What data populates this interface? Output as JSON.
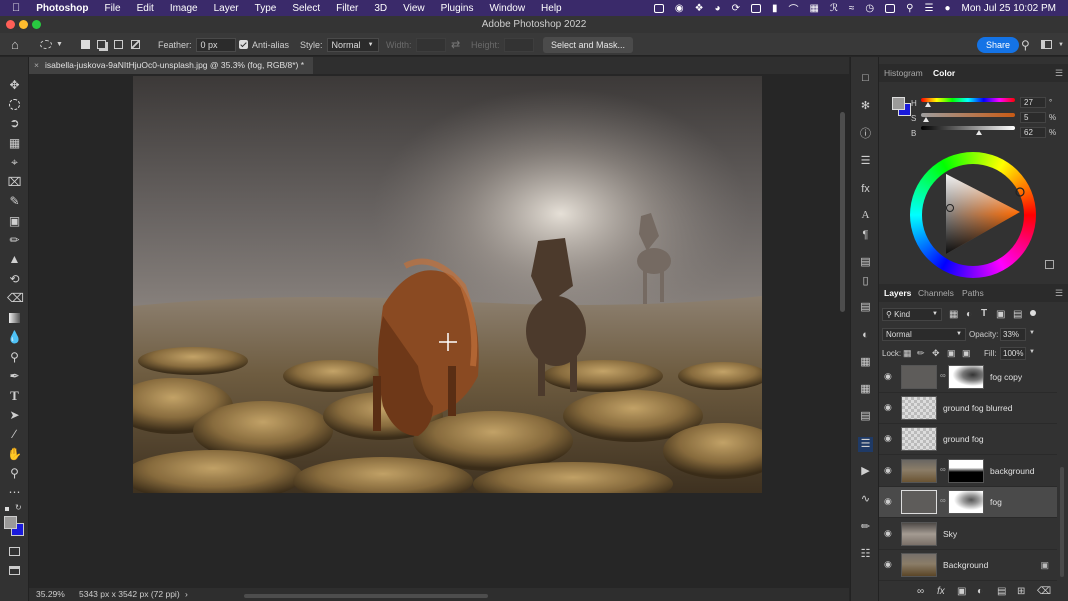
{
  "menubar": {
    "app": "Photoshop",
    "items": [
      "File",
      "Edit",
      "Image",
      "Layer",
      "Type",
      "Select",
      "Filter",
      "3D",
      "View",
      "Plugins",
      "Window",
      "Help"
    ],
    "datetime": "Mon Jul 25  10:02 PM"
  },
  "window": {
    "title": "Adobe Photoshop 2022"
  },
  "options": {
    "feather_label": "Feather:",
    "feather_value": "0 px",
    "antialias_label": "Anti-alias",
    "style_label": "Style:",
    "style_value": "Normal",
    "width_label": "Width:",
    "height_label": "Height:",
    "select_mask_label": "Select and Mask...",
    "share_label": "Share"
  },
  "document": {
    "tab_title": "isabella-juskova-9aNItHjuOc0-unsplash.jpg @ 35.3% (fog, RGB/8*) *",
    "zoom": "35.29%",
    "dimensions": "5343 px x 3542 px (72 ppi)"
  },
  "color_panel": {
    "tabs": [
      "Histogram",
      "Color"
    ],
    "active_tab": "Color",
    "h_label": "H",
    "h_value": "27",
    "h_unit": "°",
    "s_label": "S",
    "s_value": "5",
    "s_unit": "%",
    "b_label": "B",
    "b_value": "62",
    "b_unit": "%",
    "h_fraction": 0.075,
    "s_fraction": 0.05,
    "b_fraction": 0.62,
    "foreground": "#9b9a99",
    "background": "#1a1adb"
  },
  "layers_panel": {
    "tabs": [
      "Layers",
      "Channels",
      "Paths"
    ],
    "active_tab": "Layers",
    "filter_label": "Kind",
    "blend_mode": "Normal",
    "opacity_label": "Opacity:",
    "opacity_value": "33%",
    "lock_label": "Lock:",
    "fill_label": "Fill:",
    "fill_value": "100%",
    "layers": [
      {
        "name": "fog copy",
        "mask": true,
        "selected": false
      },
      {
        "name": "ground fog blurred",
        "mask": false,
        "selected": false
      },
      {
        "name": "ground fog",
        "mask": false,
        "selected": false
      },
      {
        "name": "background",
        "mask": true,
        "selected": false
      },
      {
        "name": "fog",
        "mask": true,
        "selected": true
      },
      {
        "name": "Sky",
        "mask": false,
        "selected": false
      },
      {
        "name": "Background",
        "mask": false,
        "selected": false,
        "locked": true
      }
    ]
  },
  "colors": {
    "accent": "#1473e6",
    "menubar": "#3a2a6a"
  }
}
